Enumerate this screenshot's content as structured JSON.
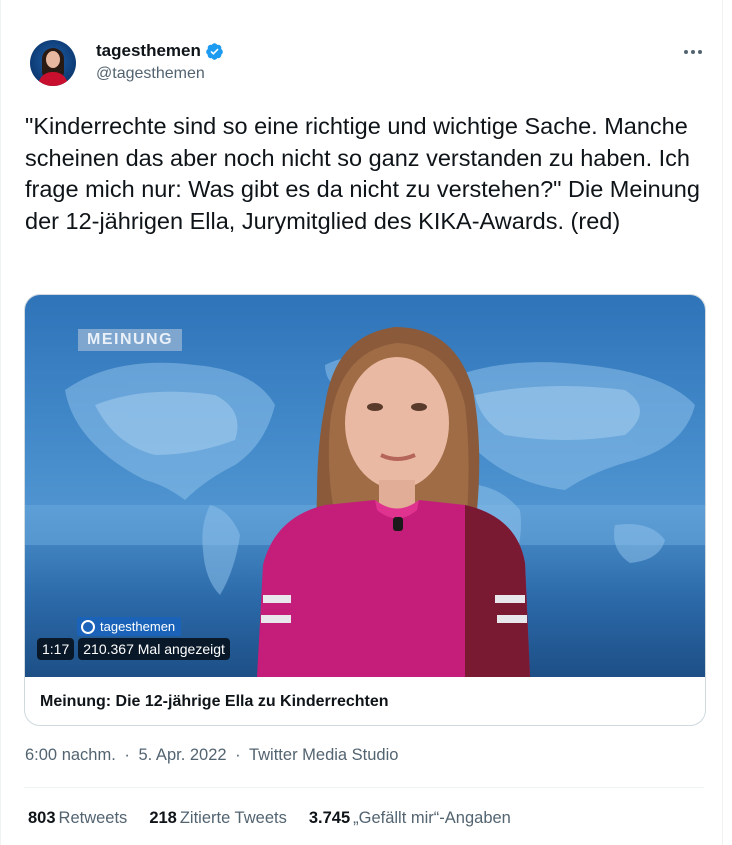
{
  "author": {
    "name": "tagesthemen",
    "handle": "@tagesthemen",
    "verified": true
  },
  "tweet": {
    "text": "\"Kinderrechte sind so eine richtige und wichtige Sache. Manche scheinen das aber noch nicht so ganz verstanden zu haben. Ich frage mich nur: Was gibt es da nicht zu verstehen?\" Die Meinung der 12-jährigen Ella, Jurymitglied des KIKA-Awards. (red)"
  },
  "media": {
    "overlay_tag": "MEINUNG",
    "logo_text": "tagesthemen",
    "duration": "1:17",
    "views": "210.367 Mal angezeigt",
    "title": "Meinung: Die 12-jährige Ella zu Kinderrechten"
  },
  "meta": {
    "time": "6:00 nachm.",
    "date": "5. Apr. 2022",
    "source": "Twitter Media Studio",
    "separator": "·"
  },
  "stats": {
    "retweets_count": "803",
    "retweets_label": "Retweets",
    "quotes_count": "218",
    "quotes_label": "Zitierte Tweets",
    "likes_count": "3.745",
    "likes_label": "„Gefällt mir“-Angaben"
  },
  "colors": {
    "verified": "#1d9bf0",
    "text_primary": "#0f1419",
    "text_secondary": "#536471"
  },
  "icons": {
    "verified": "verified-badge-icon",
    "more": "more-dots-icon"
  }
}
